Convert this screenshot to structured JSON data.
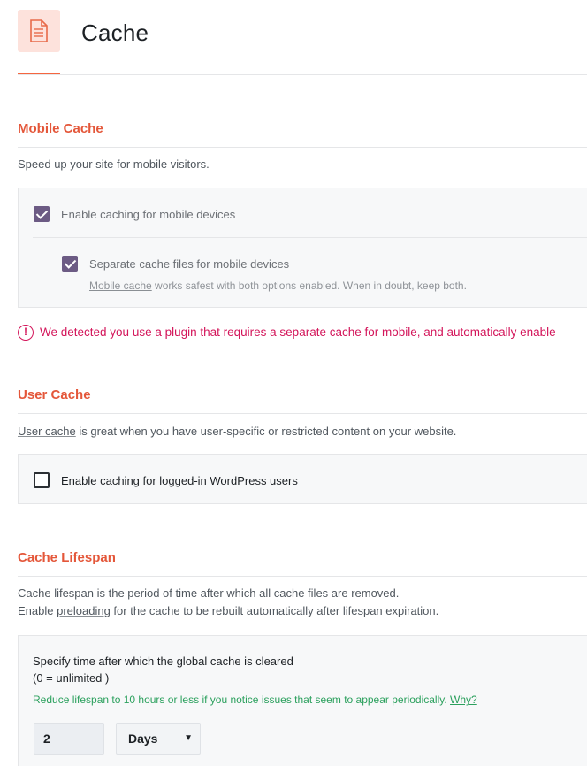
{
  "header": {
    "title": "Cache",
    "icon": "document-icon"
  },
  "mobile": {
    "title": "Mobile Cache",
    "description": "Speed up your site for mobile visitors.",
    "option1": {
      "label": "Enable caching for mobile devices",
      "checked": true
    },
    "option2": {
      "label": "Separate cache files for mobile devices",
      "checked": true
    },
    "hint_link": "Mobile cache",
    "hint_rest": " works safest with both options enabled. When in doubt, keep both.",
    "alert": "We detected you use a plugin that requires a separate cache for mobile, and automatically enable"
  },
  "user": {
    "title": "User Cache",
    "desc_link": "User cache",
    "desc_rest": " is great when you have user-specific or restricted content on your website.",
    "option": {
      "label": "Enable caching for logged-in WordPress users",
      "checked": false
    }
  },
  "lifespan": {
    "title": "Cache Lifespan",
    "desc_line1": "Cache lifespan is the period of time after which all cache files are removed.",
    "desc_line2_pre": "Enable ",
    "desc_line2_link": "preloading",
    "desc_line2_post": " for the cache to be rebuilt automatically after lifespan expiration.",
    "setting_title_1": "Specify time after which the global cache is cleared",
    "setting_title_2": "(0 = unlimited )",
    "hint": "Reduce lifespan to 10 hours or less if you notice issues that seem to appear periodically. ",
    "hint_link": "Why?",
    "value": "2",
    "unit": "Days"
  },
  "colors": {
    "accent": "#e4573a",
    "checkbox": "#6c5b84",
    "alert": "#d3155a",
    "hint_green": "#2ba05d"
  }
}
